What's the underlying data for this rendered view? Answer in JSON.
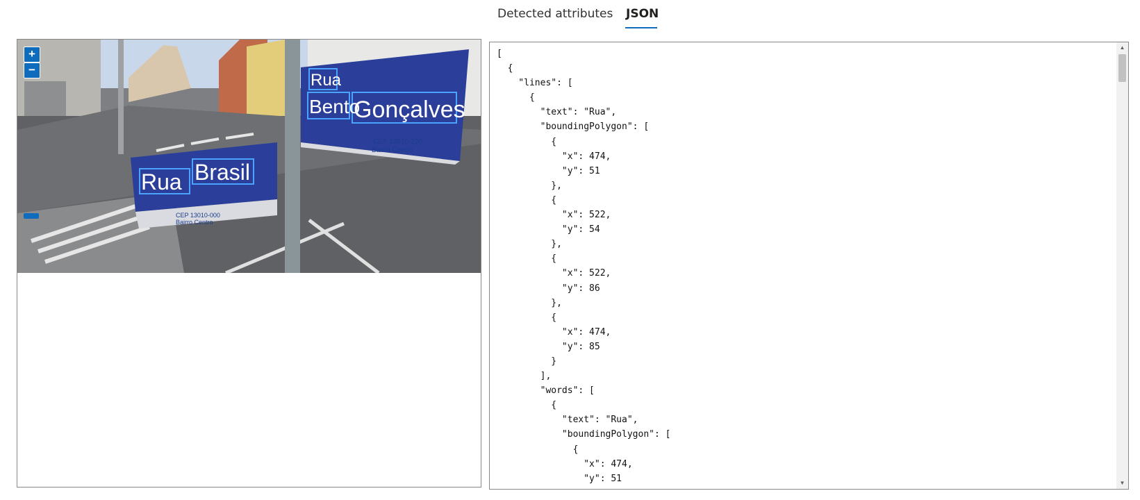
{
  "tabs": [
    {
      "label": "Detected attributes",
      "active": false
    },
    {
      "label": "JSON",
      "active": true
    }
  ],
  "viewer": {
    "zoom_in_label": "+",
    "zoom_out_label": "−",
    "zoom_level": 0.1,
    "signs": {
      "sign1_line1": "Rua",
      "sign1_line2_word1": "Bento",
      "sign1_line2_word2": "Gonçalves",
      "sign1_cep": "CEP 13010-220",
      "sign1_district": "Bairro Centro",
      "sign2_word1": "Rua",
      "sign2_word2": "Brasil",
      "sign2_cep": "CEP 13010-000",
      "sign2_district": "Bairro Centro"
    }
  },
  "json_view": {
    "lines": [
      "[",
      "  {",
      "    \"lines\": [",
      "      {",
      "        \"text\": \"Rua\",",
      "        \"boundingPolygon\": [",
      "          {",
      "            \"x\": 474,",
      "            \"y\": 51",
      "          },",
      "          {",
      "            \"x\": 522,",
      "            \"y\": 54",
      "          },",
      "          {",
      "            \"x\": 522,",
      "            \"y\": 86",
      "          },",
      "          {",
      "            \"x\": 474,",
      "            \"y\": 85",
      "          }",
      "        ],",
      "        \"words\": [",
      "          {",
      "            \"text\": \"Rua\",",
      "            \"boundingPolygon\": [",
      "              {",
      "                \"x\": 474,",
      "                \"y\": 51"
    ]
  },
  "colors": {
    "accent": "#0f6cbd",
    "sign_blue": "#2b3f9a",
    "box_blue": "#4aa3ff"
  }
}
